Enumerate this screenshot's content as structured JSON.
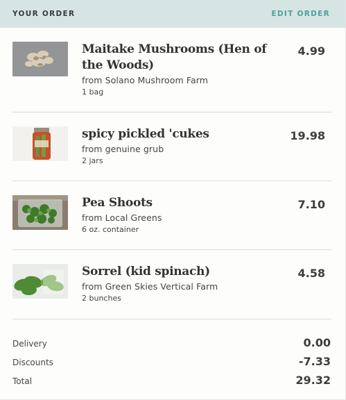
{
  "header": {
    "title": "YOUR ORDER",
    "edit_label": "EDIT ORDER",
    "background": "#d7e4e4",
    "accent": "#4aa39a"
  },
  "items": [
    {
      "name_line1": "Maitake Mushrooms (Hen of",
      "name_line2": "the Woods)",
      "source": "from Solano Mushroom Farm",
      "quantity": "1 bag",
      "price": "4.99",
      "image": "maitake-mushrooms-photo"
    },
    {
      "name_line1": "spicy pickled 'cukes",
      "source": "from genuine grub",
      "quantity": "2 jars",
      "price": "19.98",
      "image": "pickle-jar-photo"
    },
    {
      "name_line1": "Pea Shoots",
      "source": "from Local Greens",
      "quantity": "6 oz. container",
      "price": "7.10",
      "image": "pea-shoots-container-photo"
    },
    {
      "name_line1": "Sorrel (kid spinach)",
      "source": "from Green Skies Vertical Farm",
      "quantity": "2 bunches",
      "price": "4.58",
      "image": "sorrel-bunches-photo"
    }
  ],
  "totals": {
    "delivery_label": "Delivery",
    "delivery_value": "0.00",
    "discounts_label": "Discounts",
    "discounts_value": "-7.33",
    "total_label": "Total",
    "total_value": "29.32"
  }
}
